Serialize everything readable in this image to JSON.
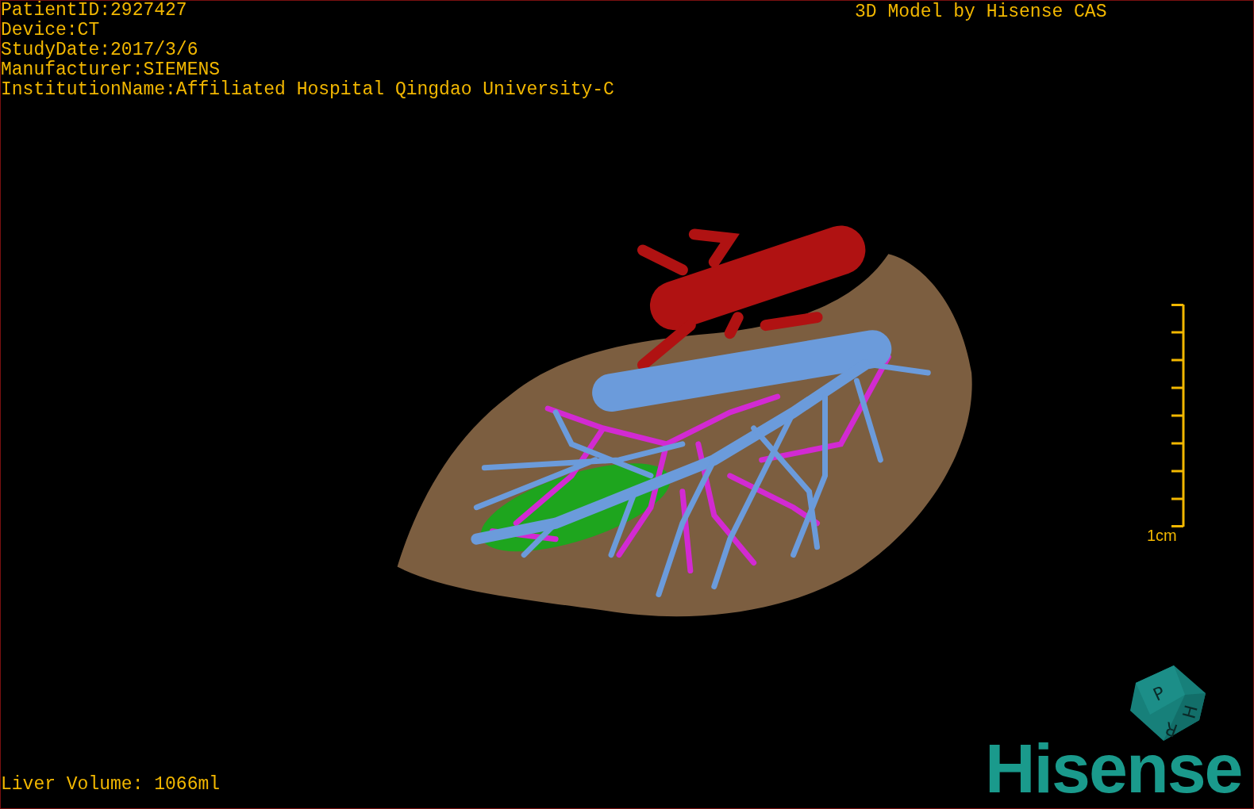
{
  "info_lines": [
    "PatientID:2927427",
    "Device:CT",
    "StudyDate:2017/3/6",
    "Manufacturer:SIEMENS",
    "InstitutionName:Affiliated Hospital Qingdao University-C"
  ],
  "title": "3D Model by Hisense CAS",
  "scale_bar": {
    "label": "1cm"
  },
  "orientation_cube": {
    "faces": [
      "P",
      "H",
      "R"
    ]
  },
  "logo": "Hisense",
  "footer": "Liver Volume: 1066ml"
}
